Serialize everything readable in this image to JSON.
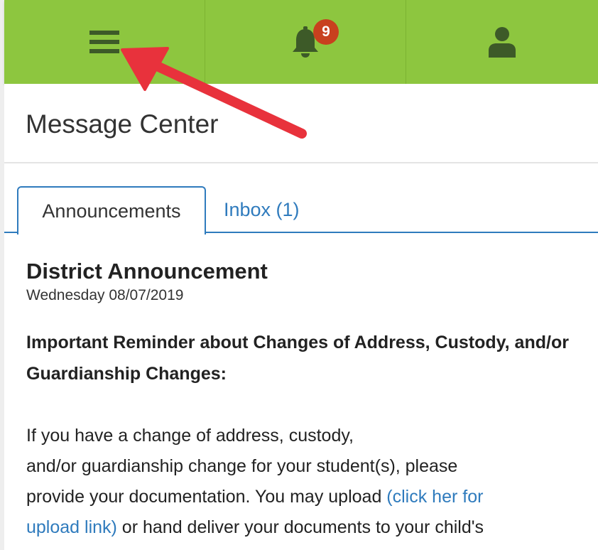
{
  "topbar": {
    "menu_icon": "hamburger-menu-icon",
    "notifications_icon": "bell-icon",
    "notification_count": "9",
    "profile_icon": "user-icon"
  },
  "header": {
    "title": "Message Center"
  },
  "tabs": [
    {
      "label": "Announcements",
      "active": true
    },
    {
      "label": "Inbox (1)",
      "active": false
    }
  ],
  "announcement": {
    "title": "District Announcement",
    "date": "Wednesday 08/07/2019",
    "heading": "Important Reminder about Changes of Address, Custody, and/or Guardianship Changes:",
    "body_line1": "If you have a change of address, custody,",
    "body_line2": "and/or guardianship change for your student(s), please",
    "body_line3": "provide your documentation.  You may upload ",
    "link_part1": "(click her for",
    "link_part2": "upload link)",
    "body_line4_rest": " or hand deliver your documents to your child's"
  },
  "colors": {
    "topbar": "#8dc63f",
    "icon": "#3d5a28",
    "badge": "#c8401e",
    "link": "#2f7bbd",
    "annotation_arrow": "#e8323c"
  }
}
